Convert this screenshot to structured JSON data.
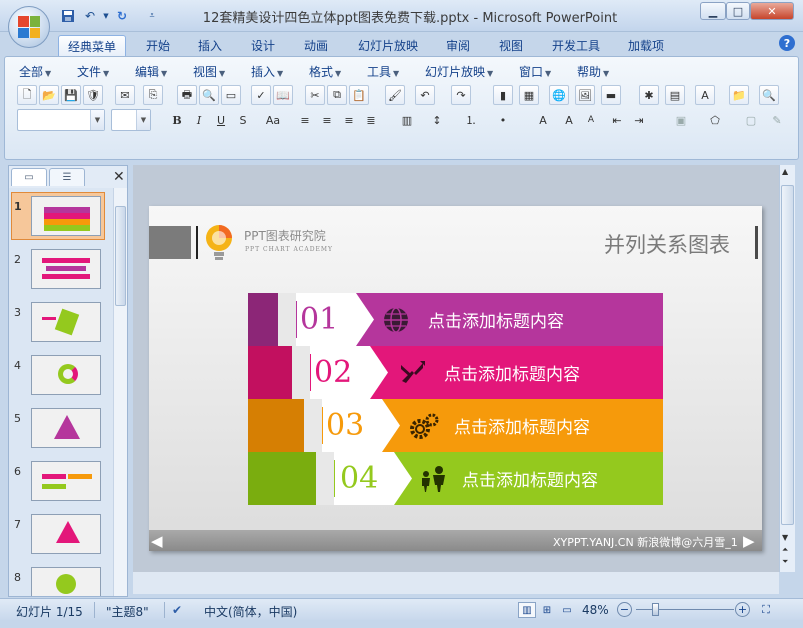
{
  "window": {
    "title": "12套精美设计四色立体ppt图表免费下载.pptx - Microsoft PowerPoint"
  },
  "ribbon_tabs": [
    "经典菜单",
    "开始",
    "插入",
    "设计",
    "动画",
    "幻灯片放映",
    "审阅",
    "视图",
    "开发工具",
    "加载项"
  ],
  "menu_bar": [
    "全部",
    "文件",
    "编辑",
    "视图",
    "插入",
    "格式",
    "工具",
    "幻灯片放映",
    "窗口",
    "帮助"
  ],
  "slide": {
    "brand": "PPT图表研究院",
    "brand_sub": "PPT CHART ACADEMY",
    "heading": "并列关系图表",
    "footer": "XYPPT.YANJ.CN 新浪微博@六月雪_1",
    "rows": [
      {
        "num": "01",
        "text": "点击添加标题内容",
        "icon": "globe-icon",
        "color": "#b5369c"
      },
      {
        "num": "02",
        "text": "点击添加标题内容",
        "icon": "arrows-icon",
        "color": "#e3177a"
      },
      {
        "num": "03",
        "text": "点击添加标题内容",
        "icon": "gears-icon",
        "color": "#f69a0b"
      },
      {
        "num": "04",
        "text": "点击添加标题内容",
        "icon": "people-icon",
        "color": "#94c91e"
      }
    ]
  },
  "thumbnails": [
    "1",
    "2",
    "3",
    "4",
    "5",
    "6",
    "7",
    "8"
  ],
  "status": {
    "slide_info": "幻灯片 1/15",
    "theme": "\"主题8\"",
    "language": "中文(简体，中国)",
    "zoom": "48%"
  },
  "colors": {
    "accent": "#15428b",
    "purple": "#b5369c",
    "magenta": "#e3177a",
    "orange": "#f69a0b",
    "green": "#94c91e"
  }
}
